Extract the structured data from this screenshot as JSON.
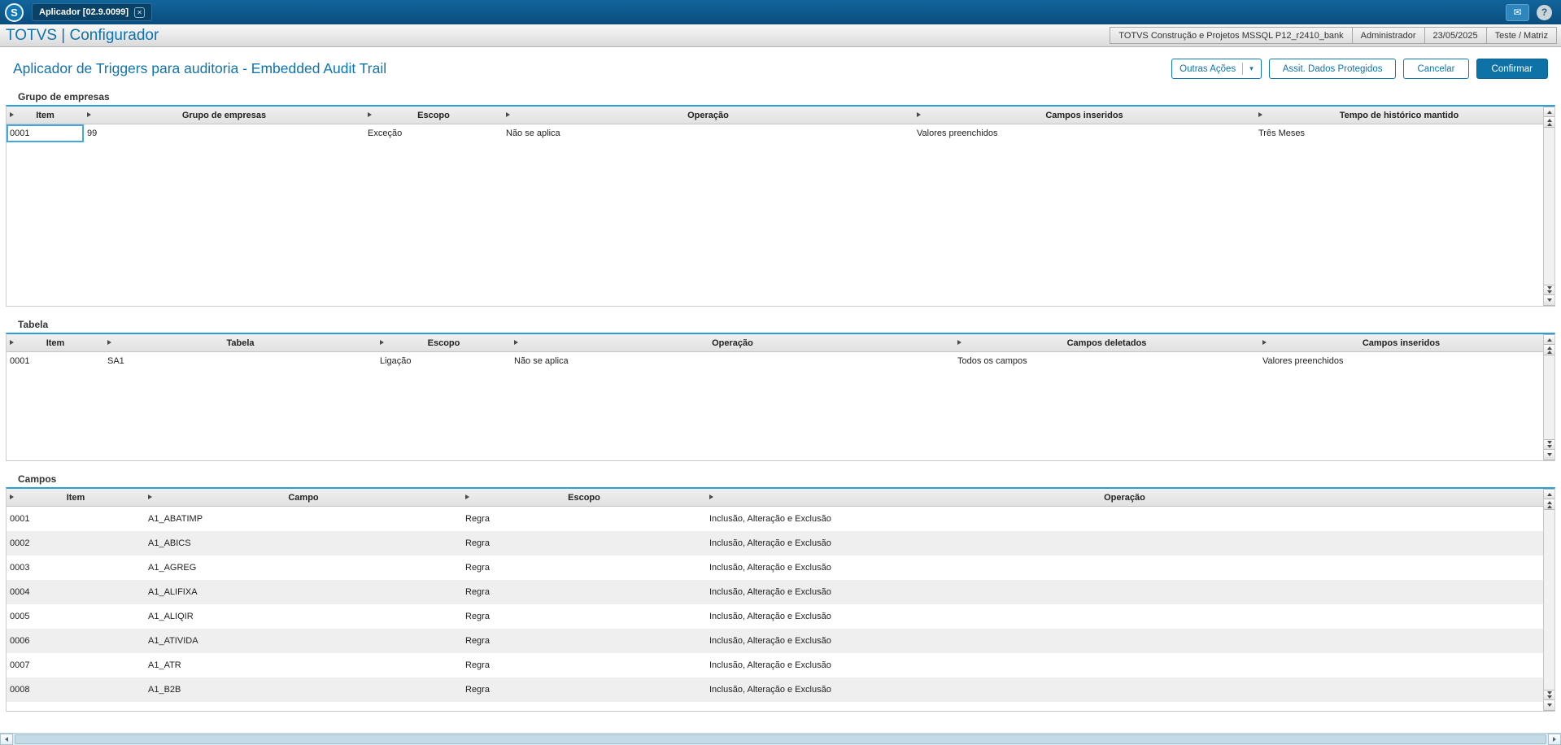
{
  "topbar": {
    "tab": "Aplicador [02.9.0099]"
  },
  "appbar": {
    "brand": "TOTVS | Configurador",
    "info": [
      "TOTVS Construção e Projetos MSSQL P12_r2410_bank",
      "Administrador",
      "23/05/2025",
      "Teste / Matriz"
    ]
  },
  "page": {
    "title": "Aplicador de Triggers para auditoria - Embedded Audit Trail",
    "actions": {
      "outras_acoes": "Outras Ações",
      "assit_dados": "Assit. Dados Protegidos",
      "cancelar": "Cancelar",
      "confirmar": "Confirmar"
    }
  },
  "grids": {
    "grupo": {
      "title": "Grupo de empresas",
      "columns": [
        "Item",
        "Grupo de empresas",
        "Escopo",
        "Operação",
        "Campos inseridos",
        "Tempo de histórico mantido"
      ],
      "rows": [
        [
          "0001",
          "99",
          "Exceção",
          "Não se aplica",
          "Valores preenchidos",
          "Três Meses"
        ]
      ]
    },
    "tabela": {
      "title": "Tabela",
      "columns": [
        "Item",
        "Tabela",
        "Escopo",
        "Operação",
        "Campos deletados",
        "Campos inseridos"
      ],
      "rows": [
        [
          "0001",
          "SA1",
          "Ligação",
          "Não se aplica",
          "Todos os campos",
          "Valores preenchidos"
        ]
      ]
    },
    "campos": {
      "title": "Campos",
      "columns": [
        "Item",
        "Campo",
        "Escopo",
        "Operação"
      ],
      "rows": [
        [
          "0001",
          "A1_ABATIMP",
          "Regra",
          "Inclusão, Alteração e Exclusão"
        ],
        [
          "0002",
          "A1_ABICS",
          "Regra",
          "Inclusão, Alteração e Exclusão"
        ],
        [
          "0003",
          "A1_AGREG",
          "Regra",
          "Inclusão, Alteração e Exclusão"
        ],
        [
          "0004",
          "A1_ALIFIXA",
          "Regra",
          "Inclusão, Alteração e Exclusão"
        ],
        [
          "0005",
          "A1_ALIQIR",
          "Regra",
          "Inclusão, Alteração e Exclusão"
        ],
        [
          "0006",
          "A1_ATIVIDA",
          "Regra",
          "Inclusão, Alteração e Exclusão"
        ],
        [
          "0007",
          "A1_ATR",
          "Regra",
          "Inclusão, Alteração e Exclusão"
        ],
        [
          "0008",
          "A1_B2B",
          "Regra",
          "Inclusão, Alteração e Exclusão"
        ]
      ]
    }
  },
  "colors": {
    "topbar": "#0a4d7e",
    "topbar_light": "#11659c",
    "accent": "#0e74ad",
    "grid_top_border": "#2d9fd8"
  }
}
